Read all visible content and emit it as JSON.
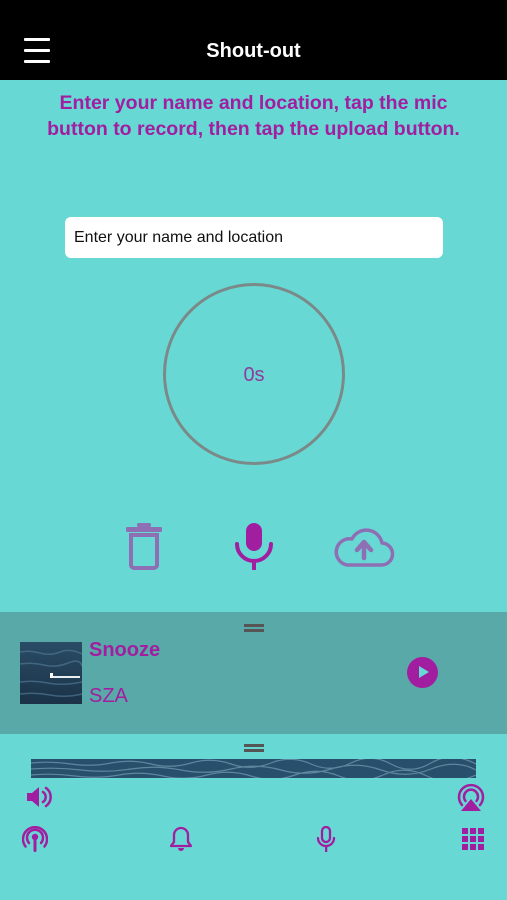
{
  "header": {
    "title": "Shout-out"
  },
  "instructions": "Enter your name and location, tap the mic button to record, then tap the upload button.",
  "name_input": {
    "placeholder": "Enter your name and location",
    "value": ""
  },
  "timer": {
    "text": "0s"
  },
  "controls": {
    "delete_icon": "trash-icon",
    "record_icon": "microphone-icon",
    "upload_icon": "cloud-upload-icon"
  },
  "now_playing": {
    "title": "Snooze",
    "artist": "SZA"
  },
  "bottom_nav": {
    "items": [
      "podcast-icon",
      "bell-icon",
      "microphone-icon",
      "grid-icon"
    ]
  },
  "colors": {
    "background": "#68d8d4",
    "accent": "#a21ea0",
    "header": "#000000",
    "controls_muted": "#8f6fb4",
    "player_bg": "#58a9a7"
  }
}
